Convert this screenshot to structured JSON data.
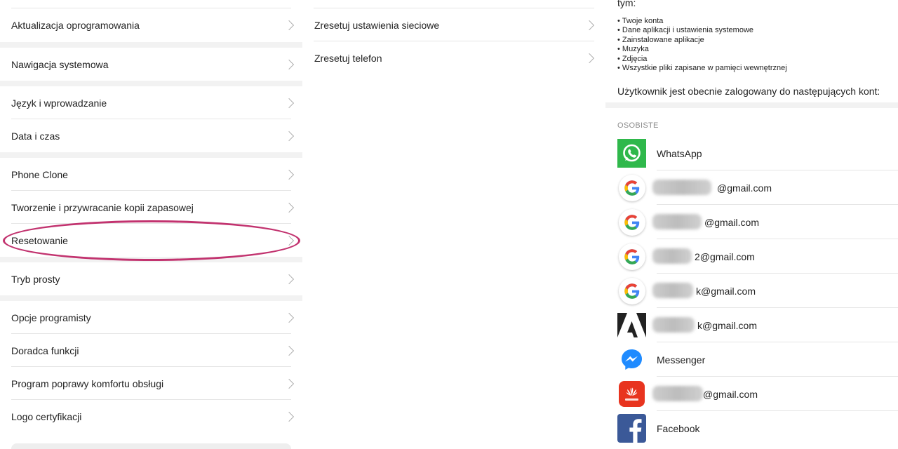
{
  "panel_left": {
    "groups": [
      {
        "items": [
          {
            "label": "Aktualizacja oprogramowania"
          }
        ]
      },
      {
        "items": [
          {
            "label": "Nawigacja systemowa"
          }
        ]
      },
      {
        "items": [
          {
            "label": "Język i wprowadzanie"
          },
          {
            "label": "Data i czas"
          }
        ]
      },
      {
        "items": [
          {
            "label": "Phone Clone"
          },
          {
            "label": "Tworzenie i przywracanie kopii zapasowej"
          },
          {
            "label": "Resetowanie"
          }
        ]
      },
      {
        "items": [
          {
            "label": "Tryb prosty"
          }
        ]
      },
      {
        "items": [
          {
            "label": "Opcje programisty"
          },
          {
            "label": "Doradca funkcji"
          },
          {
            "label": "Program poprawy komfortu obsługi"
          },
          {
            "label": "Logo certyfikacji"
          }
        ]
      }
    ],
    "highlight_color": "#c2336f"
  },
  "panel_middle": {
    "items": [
      {
        "label": "Zresetuj ustawienia sieciowe"
      },
      {
        "label": "Zresetuj telefon"
      }
    ]
  },
  "panel_right": {
    "cut_text": "tym:",
    "bullets": [
      "Twoje konta",
      "Dane aplikacji i ustawienia systemowe",
      "Zainstalowane aplikacje",
      "Muzyka",
      "Zdjęcia",
      "Wszystkie pliki zapisane w pamięci wewnętrznej"
    ],
    "accounts_text": "Użytkownik jest obecnie zalogowany do następujących kont:",
    "section_header": "OSOBISTE",
    "accounts": [
      {
        "icon": "whatsapp-icon",
        "name": "WhatsApp"
      },
      {
        "icon": "google-icon",
        "name": "@gmail.com"
      },
      {
        "icon": "google-icon",
        "name": "@gmail.com"
      },
      {
        "icon": "google-icon",
        "name": "2@gmail.com"
      },
      {
        "icon": "google-icon",
        "name": "k@gmail.com"
      },
      {
        "icon": "adobe-icon",
        "name": "k@gmail.com"
      },
      {
        "icon": "messenger-icon",
        "name": "Messenger"
      },
      {
        "icon": "huawei-icon",
        "name": "@gmail.com"
      },
      {
        "icon": "facebook-icon",
        "name": "Facebook"
      }
    ],
    "colors": {
      "whatsapp": "#2fb84b",
      "messenger": "#1f8bff",
      "huawei": "#e8341f",
      "facebook": "#3b5998",
      "adobe": "#222222"
    }
  }
}
